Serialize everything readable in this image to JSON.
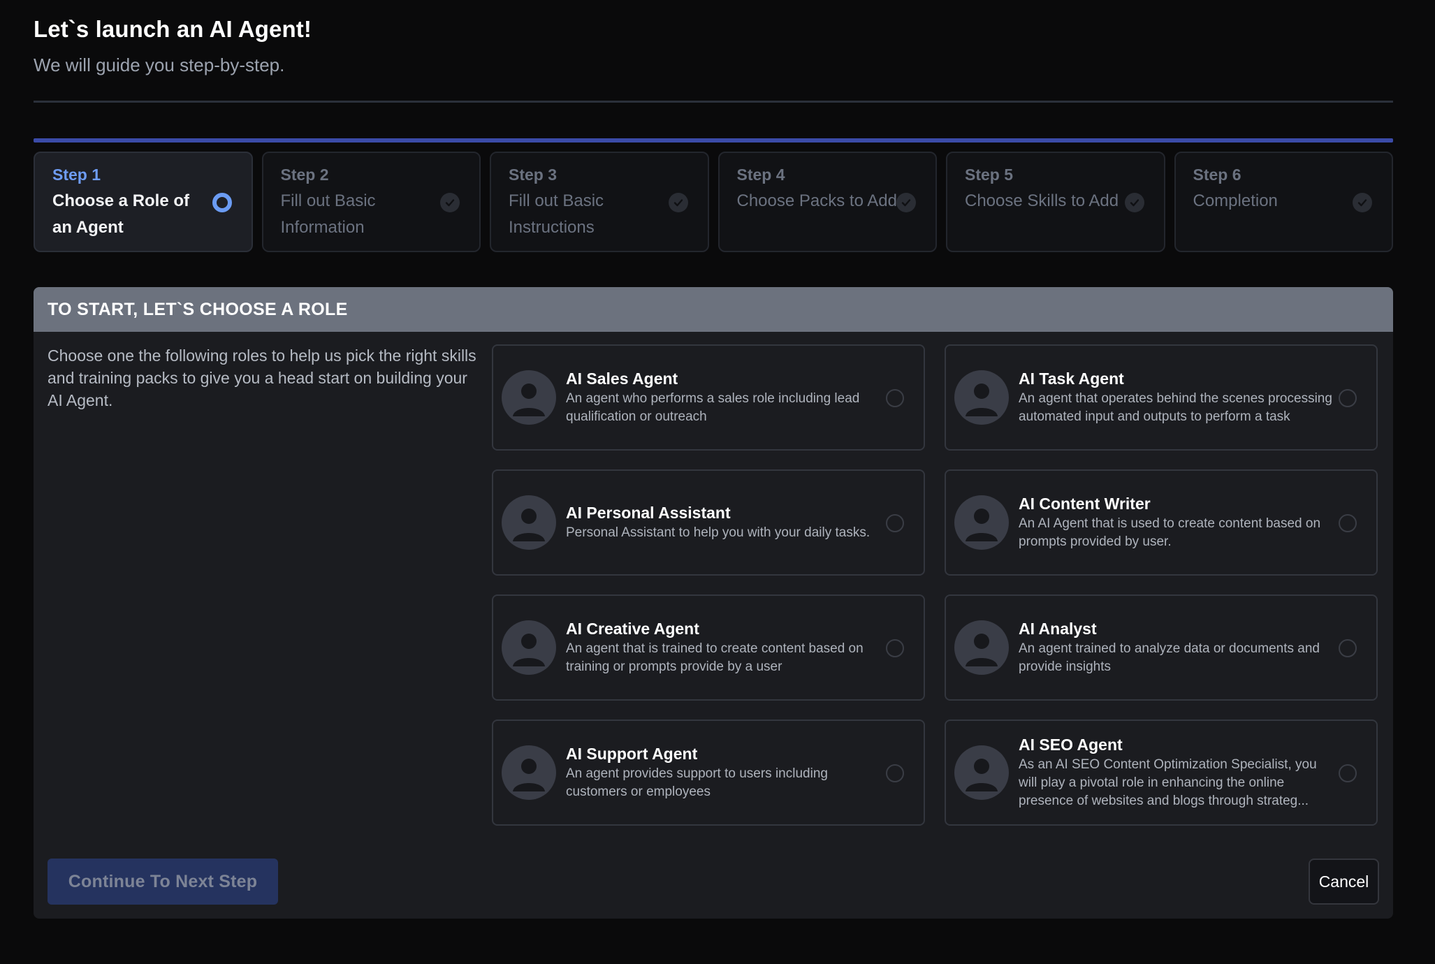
{
  "header": {
    "title": "Let`s launch an AI Agent!",
    "subtitle": "We will guide you step-by-step."
  },
  "steps": [
    {
      "num": "Step 1",
      "label": "Choose a Role of an Agent",
      "state": "active"
    },
    {
      "num": "Step 2",
      "label": "Fill out Basic Information",
      "state": "pending"
    },
    {
      "num": "Step 3",
      "label": "Fill out Basic Instructions",
      "state": "pending"
    },
    {
      "num": "Step 4",
      "label": "Choose Packs to Add",
      "state": "pending"
    },
    {
      "num": "Step 5",
      "label": "Choose Skills to Add",
      "state": "pending"
    },
    {
      "num": "Step 6",
      "label": "Completion",
      "state": "pending"
    }
  ],
  "panel": {
    "heading": "TO START, LET`S CHOOSE A ROLE",
    "intro": "Choose one the following roles to help us pick the right skills and training packs to give you a head start on building your AI Agent."
  },
  "roles": [
    {
      "title": "AI Sales Agent",
      "desc": "An agent who performs a sales role including lead qualification or outreach"
    },
    {
      "title": "AI Task Agent",
      "desc": "An agent that operates behind the scenes processing automated input and outputs to perform a task"
    },
    {
      "title": "AI Personal Assistant",
      "desc": "Personal Assistant to help you with your daily tasks."
    },
    {
      "title": "AI Content Writer",
      "desc": "An AI Agent that is used to create content based on prompts provided by user."
    },
    {
      "title": "AI Creative Agent",
      "desc": "An agent that is trained to create content based on training or prompts provide by a user"
    },
    {
      "title": "AI Analyst",
      "desc": "An agent trained to analyze data or documents and provide insights"
    },
    {
      "title": "AI Support Agent",
      "desc": "An agent provides support to users including customers or employees"
    },
    {
      "title": "AI SEO Agent",
      "desc": "As an AI SEO Content Optimization Specialist, you will play a pivotal role in enhancing the online presence of websites and blogs through strateg..."
    }
  ],
  "actions": {
    "continue_label": "Continue To Next Step",
    "cancel_label": "Cancel"
  },
  "colors": {
    "accent": "#6e9cf3",
    "progress": "#3b4ba8",
    "panel_header": "#6c727e",
    "continue_bg": "#25335f"
  },
  "icons": {
    "step_active": "radio-ring-icon",
    "step_pending": "check-circle-icon",
    "role_avatar": "user-avatar-icon"
  }
}
